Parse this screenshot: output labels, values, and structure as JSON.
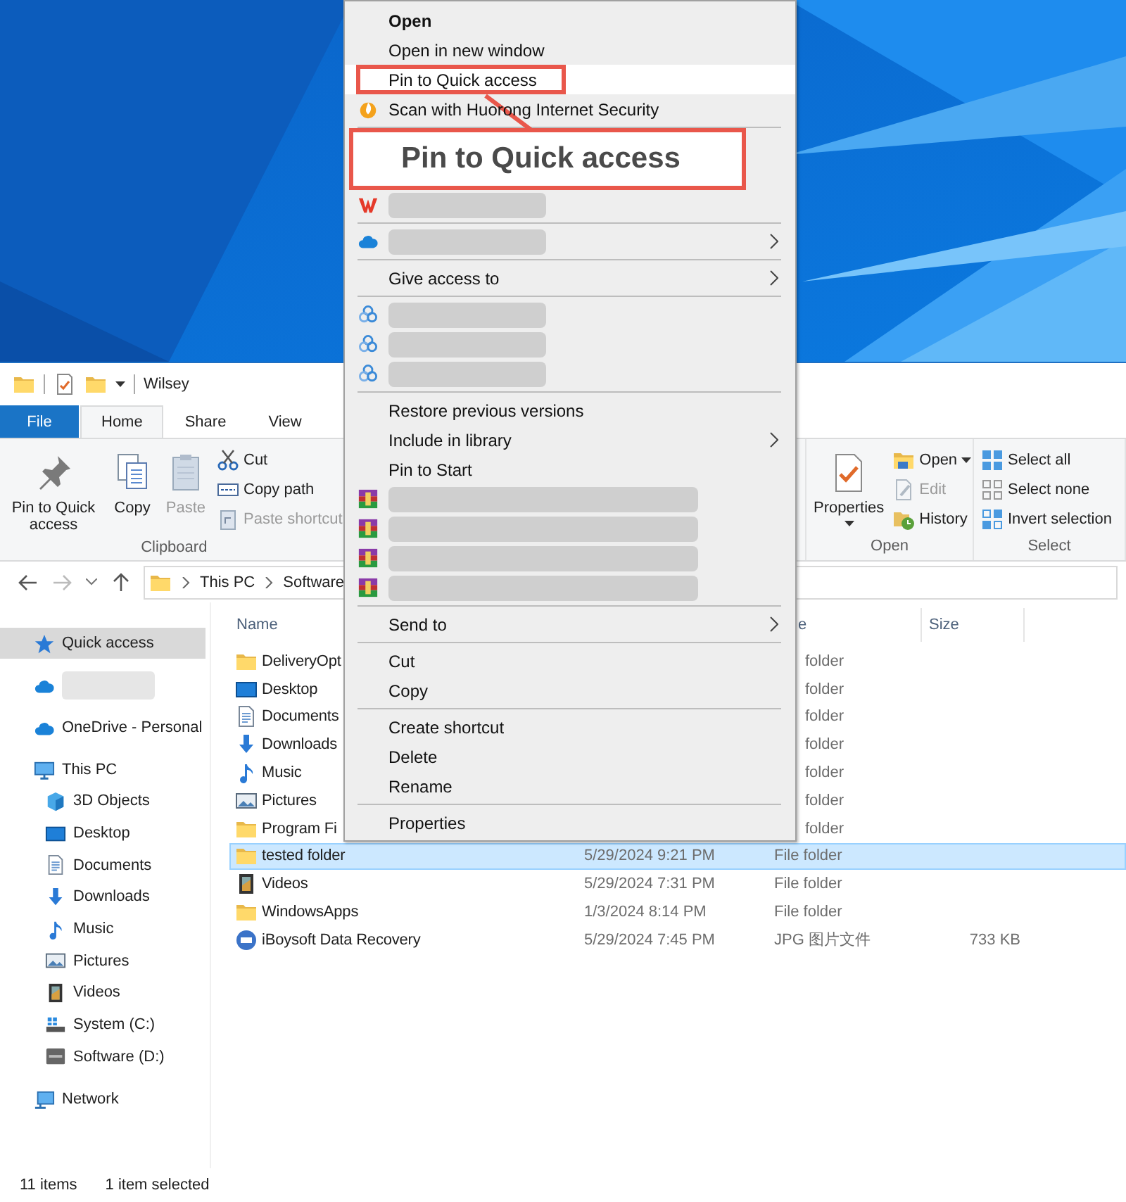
{
  "window": {
    "title": "Wilsey"
  },
  "ribbon": {
    "tabs": [
      {
        "label": "File",
        "kind": "file",
        "selected": false
      },
      {
        "label": "Home",
        "kind": "tab",
        "selected": true
      },
      {
        "label": "Share",
        "kind": "tab",
        "selected": false
      },
      {
        "label": "View",
        "kind": "tab",
        "selected": false
      }
    ],
    "groups": [
      {
        "label": "Clipboard",
        "large_buttons": [
          {
            "label": "Pin to Quick access",
            "disabled": false,
            "dropdown": false
          },
          {
            "label": "Copy",
            "disabled": false,
            "dropdown": false
          },
          {
            "label": "Paste",
            "disabled": true,
            "dropdown": false
          }
        ],
        "small_buttons": [
          {
            "label": "Cut",
            "disabled": false,
            "dropdown": false
          },
          {
            "label": "Copy path",
            "disabled": false,
            "dropdown": false
          },
          {
            "label": "Paste shortcut",
            "disabled": true,
            "dropdown": false
          }
        ]
      },
      {
        "label": "Open",
        "large_buttons": [
          {
            "label": "Properties",
            "disabled": false,
            "dropdown": true
          }
        ],
        "small_buttons": [
          {
            "label": "Open",
            "disabled": false,
            "dropdown": true
          },
          {
            "label": "Edit",
            "disabled": true,
            "dropdown": false
          },
          {
            "label": "History",
            "disabled": false,
            "dropdown": false
          }
        ]
      },
      {
        "label": "Select",
        "small_buttons": [
          {
            "label": "Select all",
            "disabled": false,
            "dropdown": false
          },
          {
            "label": "Select none",
            "disabled": false,
            "dropdown": false
          },
          {
            "label": "Invert selection",
            "disabled": false,
            "dropdown": false
          }
        ]
      }
    ]
  },
  "address": {
    "crumbs": [
      "This PC",
      "Software"
    ]
  },
  "sidebar": {
    "items": [
      {
        "label": "Quick access",
        "kind": "star",
        "selected": true
      },
      {
        "kind": "cloud",
        "blurred": true,
        "selected": false
      },
      {
        "label": "OneDrive - Personal",
        "kind": "cloud",
        "selected": false
      },
      {
        "label": "This PC",
        "kind": "pc",
        "selected": false,
        "children": [
          {
            "label": "3D Objects",
            "kind": "cube",
            "selected": false
          },
          {
            "label": "Desktop",
            "kind": "desktop",
            "selected": false
          },
          {
            "label": "Documents",
            "kind": "documents",
            "selected": false
          },
          {
            "label": "Downloads",
            "kind": "downloads",
            "selected": false
          },
          {
            "label": "Music",
            "kind": "music",
            "selected": false
          },
          {
            "label": "Pictures",
            "kind": "pictures",
            "selected": false
          },
          {
            "label": "Videos",
            "kind": "videos",
            "selected": false
          },
          {
            "label": "System (C:)",
            "kind": "drive-c",
            "selected": false
          },
          {
            "label": "Software (D:)",
            "kind": "drive",
            "selected": false
          }
        ]
      },
      {
        "label": "Network",
        "kind": "network",
        "selected": false
      }
    ]
  },
  "table": {
    "columns": [
      {
        "label": "Name"
      },
      {
        "label": "e"
      },
      {
        "label": "Size"
      }
    ],
    "rows": [
      {
        "name": "DeliveryOpt",
        "kind": "folder",
        "type": "folder",
        "selected": false
      },
      {
        "name": "Desktop",
        "kind": "desktop",
        "type": "folder",
        "selected": false
      },
      {
        "name": "Documents",
        "kind": "documents",
        "type": "folder",
        "selected": false
      },
      {
        "name": "Downloads",
        "kind": "downloads",
        "type": "folder",
        "selected": false
      },
      {
        "name": "Music",
        "kind": "music",
        "type": "folder",
        "selected": false
      },
      {
        "name": "Pictures",
        "kind": "pictures",
        "type": "folder",
        "selected": false
      },
      {
        "name": "Program Fi",
        "kind": "folder",
        "type": "folder",
        "selected": false
      },
      {
        "name": "tested folder",
        "kind": "folder",
        "date_modified": "5/29/2024 9:21 PM",
        "type": "File folder",
        "selected": true
      },
      {
        "name": "Videos",
        "kind": "videos",
        "date_modified": "5/29/2024 7:31 PM",
        "type": "File folder",
        "selected": false
      },
      {
        "name": "WindowsApps",
        "kind": "folder",
        "date_modified": "1/3/2024 8:14 PM",
        "type": "File folder",
        "selected": false
      },
      {
        "name": "iBoysoft Data Recovery",
        "kind": "jpg",
        "date_modified": "5/29/2024 7:45 PM",
        "type": "JPG 图片文件",
        "size": "733 KB",
        "selected": false
      }
    ]
  },
  "status_bar": {
    "item_count": "11 items",
    "selection": "1 item selected"
  },
  "context_menu": {
    "items": [
      {
        "kind": "item",
        "label": "Open",
        "bold": true,
        "selected": false,
        "submenu": false,
        "highlighted": false
      },
      {
        "kind": "item",
        "label": "Open in new window",
        "bold": false,
        "selected": false,
        "submenu": false,
        "highlighted": false
      },
      {
        "kind": "item",
        "label": "Pin to Quick access",
        "bold": false,
        "selected": true,
        "submenu": false,
        "highlighted": true
      },
      {
        "kind": "item",
        "label": "Scan with Huorong Internet Security",
        "bold": false,
        "selected": false,
        "submenu": false,
        "highlighted": false
      },
      {
        "kind": "separator"
      },
      {
        "kind": "callout",
        "label": "Pin to Quick access"
      },
      {
        "kind": "blurred",
        "submenu": false
      },
      {
        "kind": "separator"
      },
      {
        "kind": "blurred",
        "submenu": true
      },
      {
        "kind": "separator"
      },
      {
        "kind": "item",
        "label": "Give access to",
        "bold": false,
        "selected": false,
        "submenu": true,
        "highlighted": false
      },
      {
        "kind": "separator"
      },
      {
        "kind": "blurred",
        "submenu": false
      },
      {
        "kind": "blurred",
        "submenu": false
      },
      {
        "kind": "blurred",
        "submenu": false
      },
      {
        "kind": "separator"
      },
      {
        "kind": "item",
        "label": "Restore previous versions",
        "bold": false,
        "selected": false,
        "submenu": false,
        "highlighted": false
      },
      {
        "kind": "item",
        "label": "Include in library",
        "bold": false,
        "selected": false,
        "submenu": true,
        "highlighted": false
      },
      {
        "kind": "item",
        "label": "Pin to Start",
        "bold": false,
        "selected": false,
        "submenu": false,
        "highlighted": false
      },
      {
        "kind": "blurred",
        "submenu": false
      },
      {
        "kind": "blurred",
        "submenu": false
      },
      {
        "kind": "blurred",
        "submenu": false
      },
      {
        "kind": "blurred",
        "submenu": false
      },
      {
        "kind": "separator"
      },
      {
        "kind": "item",
        "label": "Send to",
        "bold": false,
        "selected": false,
        "submenu": true,
        "highlighted": false
      },
      {
        "kind": "separator"
      },
      {
        "kind": "item",
        "label": "Cut",
        "bold": false,
        "selected": false,
        "submenu": false,
        "highlighted": false
      },
      {
        "kind": "item",
        "label": "Copy",
        "bold": false,
        "selected": false,
        "submenu": false,
        "highlighted": false
      },
      {
        "kind": "separator"
      },
      {
        "kind": "item",
        "label": "Create shortcut",
        "bold": false,
        "selected": false,
        "submenu": false,
        "highlighted": false
      },
      {
        "kind": "item",
        "label": "Delete",
        "bold": false,
        "selected": false,
        "submenu": false,
        "highlighted": false
      },
      {
        "kind": "item",
        "label": "Rename",
        "bold": false,
        "selected": false,
        "submenu": false,
        "highlighted": false
      },
      {
        "kind": "separator"
      },
      {
        "kind": "item",
        "label": "Properties",
        "bold": false,
        "selected": false,
        "submenu": false,
        "highlighted": false
      }
    ]
  }
}
